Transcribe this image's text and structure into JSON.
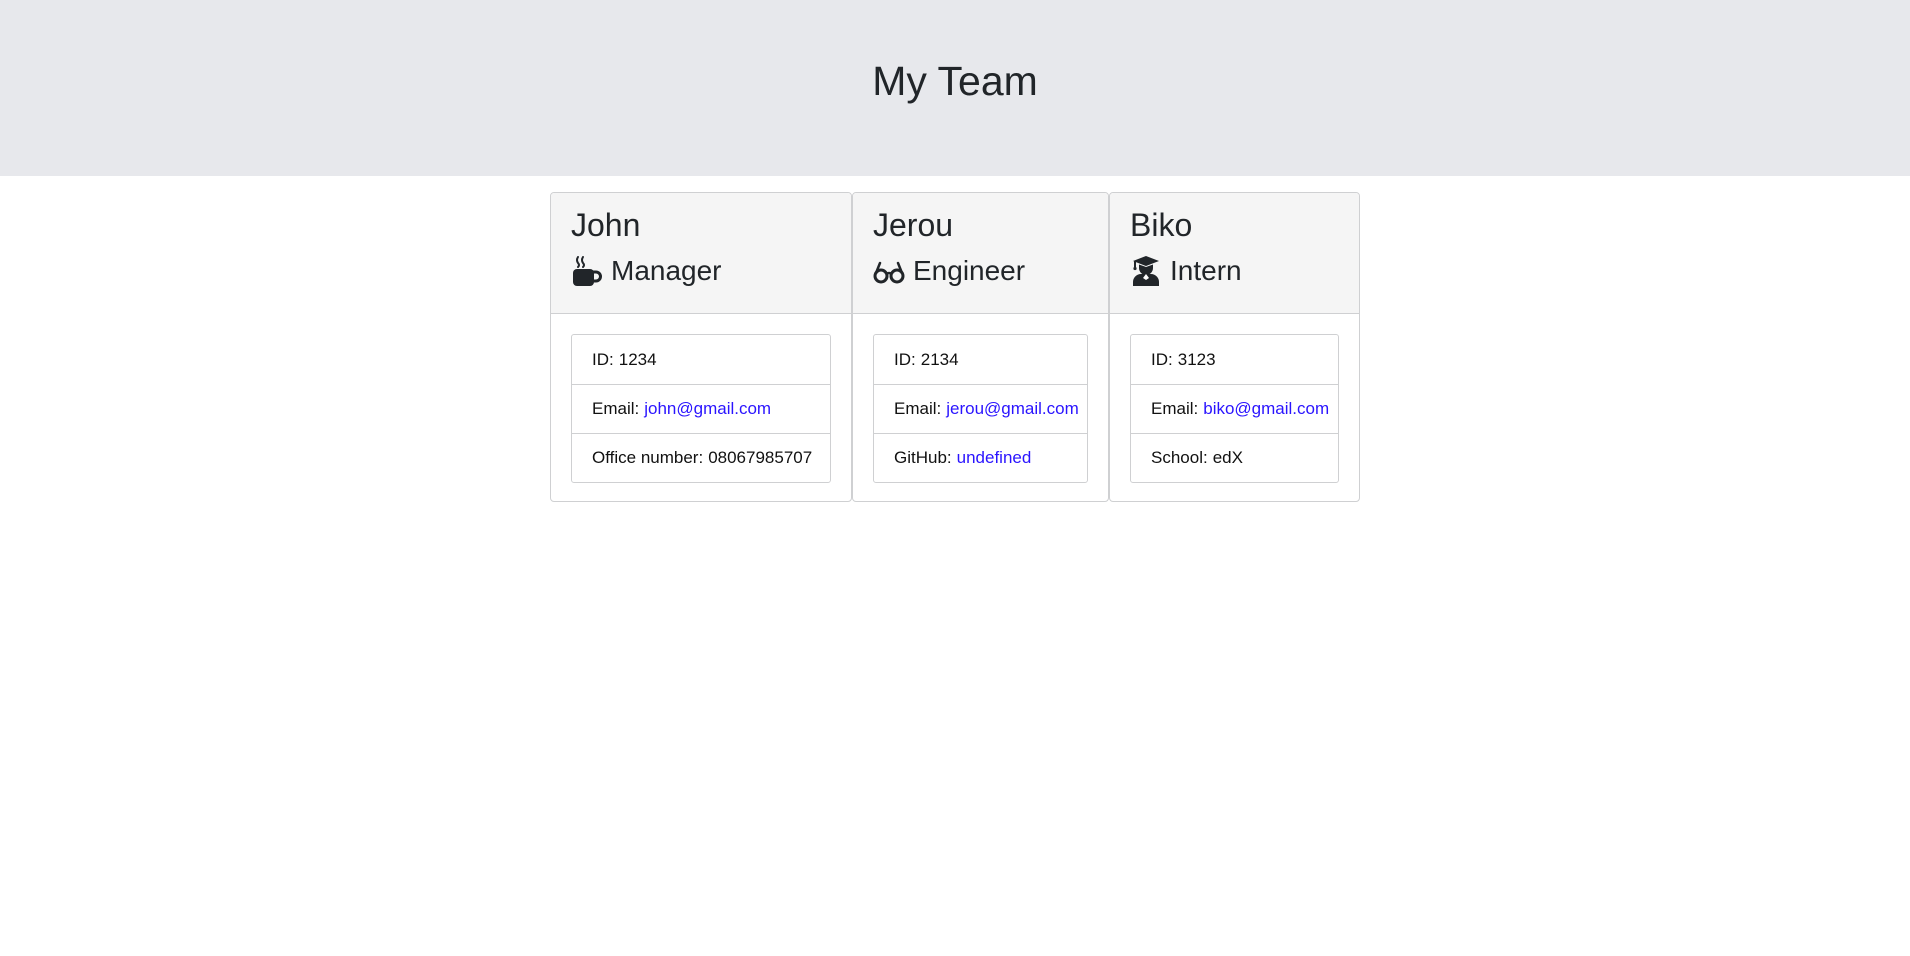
{
  "header": {
    "title": "My Team"
  },
  "cards": [
    {
      "name": "John",
      "role": "Manager",
      "icon": "mug-icon",
      "id_label": "ID:",
      "id_value": "1234",
      "email_label": "Email:",
      "email_value": "john@gmail.com",
      "extra_label": "Office number:",
      "extra_value": "08067985707"
    },
    {
      "name": "Jerou",
      "role": "Engineer",
      "icon": "glasses-icon",
      "id_label": "ID:",
      "id_value": "2134",
      "email_label": "Email:",
      "email_value": "jerou@gmail.com",
      "extra_label": "GitHub:",
      "extra_value": "undefined"
    },
    {
      "name": "Biko",
      "role": "Intern",
      "icon": "graduate-icon",
      "id_label": "ID:",
      "id_value": "3123",
      "email_label": "Email:",
      "email_value": "biko@gmail.com",
      "extra_label": "School:",
      "extra_value": "edX"
    }
  ],
  "colors": {
    "link": "#2a14ff",
    "header_bg": "#e7e8ec",
    "card_header_bg": "#f5f5f5"
  }
}
